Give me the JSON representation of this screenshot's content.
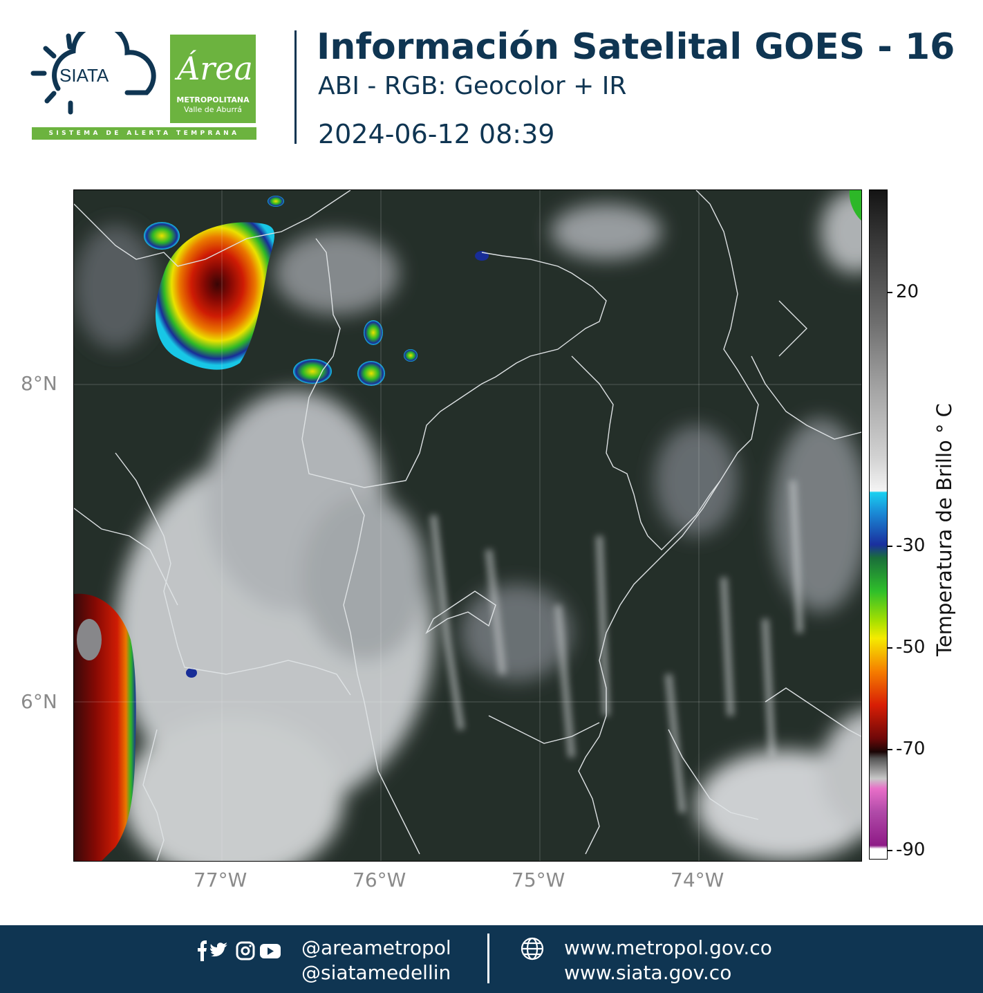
{
  "header": {
    "logo_siata_text": "SIATA",
    "logo_area_word": "Área",
    "logo_area_line1": "METROPOLITANA",
    "logo_area_line2": "Valle de Aburrá",
    "logo_tagline": "SISTEMA DE ALERTA TEMPRANA",
    "title": "Información Satelital GOES - 16",
    "subtitle": "ABI - RGB: Geocolor + IR",
    "datetime": "2024-06-12 08:39"
  },
  "map": {
    "lat_labels": [
      "8°N",
      "6°N"
    ],
    "lon_labels": [
      "77°W",
      "76°W",
      "75°W",
      "74°W"
    ]
  },
  "colorbar": {
    "label": "Temperatura de Brillo ° C",
    "tick_labels": [
      "20",
      "-30",
      "-50",
      "-70",
      "-90"
    ],
    "colors": {
      "cold_top": "#8e1a86",
      "magenta": "#e86fc8",
      "black": "#1a0606",
      "red": "#d81e05",
      "orange": "#f57d00",
      "yellow": "#f5eb00",
      "green": "#2fbf2a",
      "blue": "#1a2f9e",
      "cyan": "#19d0f0",
      "white": "#ffffff"
    }
  },
  "footer": {
    "handle1": "@areametropol",
    "handle2": "@siatamedellin",
    "web1": "www.metropol.gov.co",
    "web2": "www.siata.gov.co",
    "social_icons": [
      "facebook-icon",
      "twitter-icon",
      "instagram-icon",
      "youtube-icon"
    ]
  }
}
